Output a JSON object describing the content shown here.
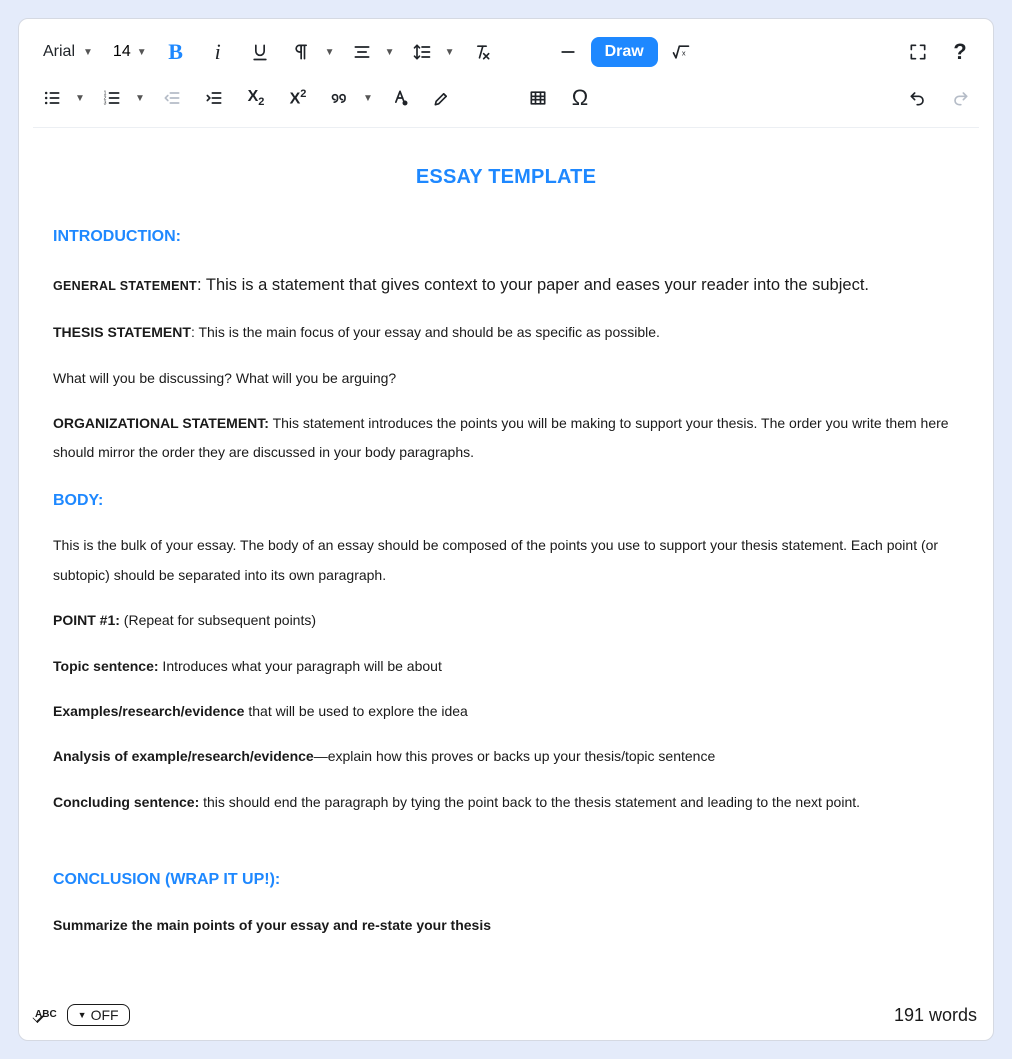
{
  "toolbar": {
    "font_family": "Arial",
    "font_size": "14",
    "draw_label": "Draw"
  },
  "status": {
    "spell_label": "ABC",
    "off_label": "OFF",
    "word_count": "191 words"
  },
  "doc": {
    "title": "ESSAY TEMPLATE",
    "intro": {
      "heading": "INTRODUCTION:",
      "general_label": "GENERAL STATEMENT",
      "general_sep": ": ",
      "general_text": "This is a statement that gives context to your paper and eases your reader into the subject.",
      "thesis_label": "THESIS STATEMENT",
      "thesis_sep": ": ",
      "thesis_text": "This is the main focus of your essay and should be as specific as possible.",
      "thesis_q": "What will you be discussing? What will you be arguing?",
      "org_label": "ORGANIZATIONAL STATEMENT:",
      "org_text": " This statement introduces the points you will be making to support your thesis. The order you write them here should mirror the order they are discussed in your body paragraphs."
    },
    "body": {
      "heading": "BODY:",
      "intro": "This is the bulk of your essay. The body of an essay should be composed of the points you use to support your thesis statement. Each point (or subtopic) should be separated into its own paragraph.",
      "point_label": "POINT #1:",
      "point_text": " (Repeat for subsequent points)",
      "topic_label": "Topic sentence:",
      "topic_text": " Introduces what your paragraph will be about",
      "ex_label": "Examples/research/evidence",
      "ex_text": " that will be used to explore the idea",
      "an_label": "Analysis of example/research/evidence",
      "an_text": "—explain how this proves or backs up your thesis/topic sentence",
      "conc_label": "Concluding sentence:",
      "conc_text": " this should end the paragraph by tying the point back to the thesis statement and leading to the next point."
    },
    "conclusion": {
      "heading": "CONCLUSION (WRAP IT UP!):",
      "text": "Summarize the main points of your essay and re-state your thesis"
    }
  }
}
